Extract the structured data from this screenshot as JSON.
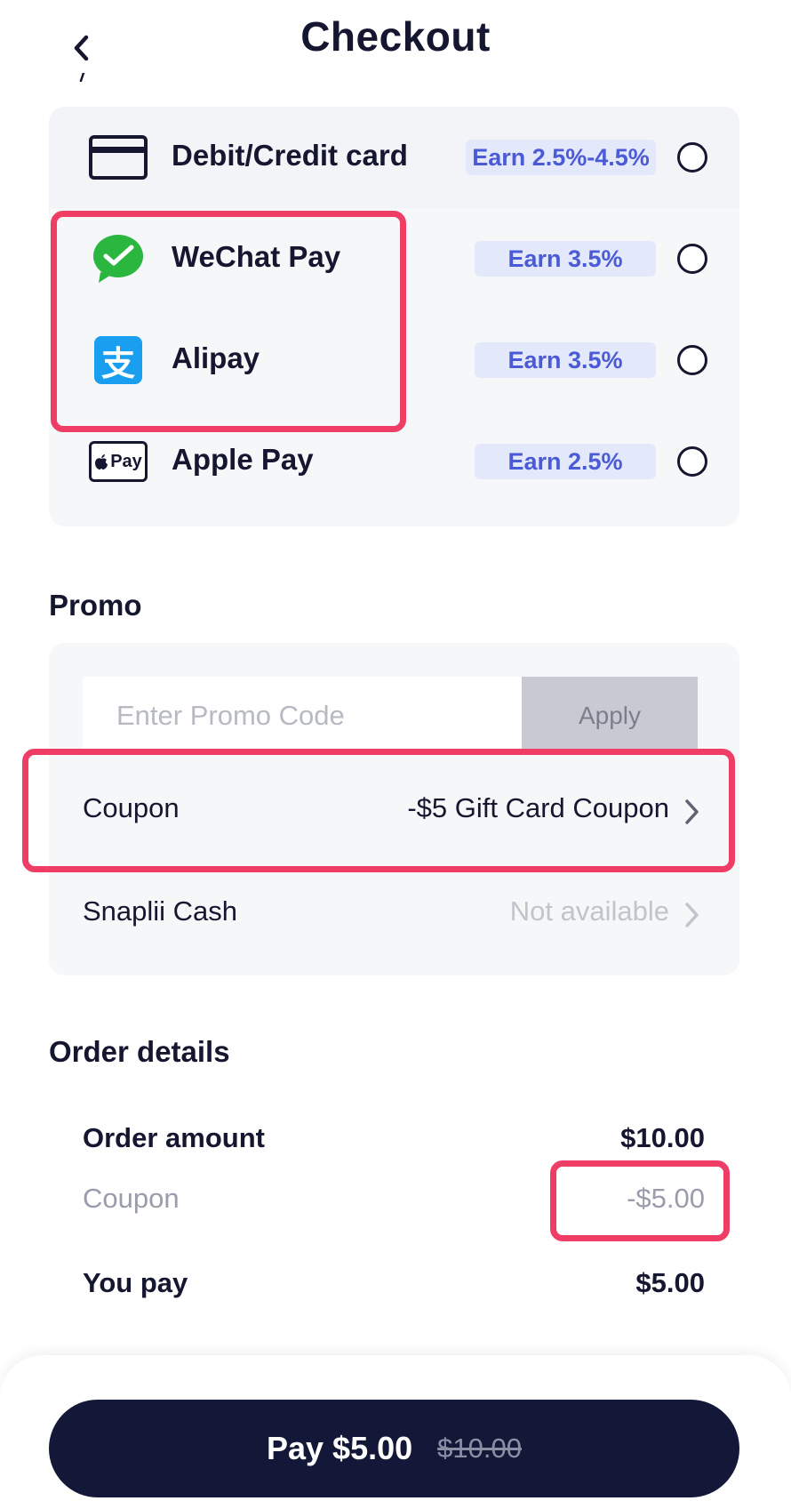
{
  "header": {
    "title": "Checkout",
    "back_icon": "chevron-left-icon"
  },
  "payment_methods": [
    {
      "name": "Debit/Credit card",
      "earn": "Earn 2.5%-4.5%",
      "icon": "credit-card-icon",
      "selected": false
    },
    {
      "name": "WeChat Pay",
      "earn": "Earn 3.5%",
      "icon": "wechat-pay-icon",
      "selected": false
    },
    {
      "name": "Alipay",
      "earn": "Earn 3.5%",
      "icon": "alipay-icon",
      "selected": false
    },
    {
      "name": "Apple Pay",
      "earn": "Earn 2.5%",
      "icon": "apple-pay-icon",
      "selected": false
    }
  ],
  "apple_pay_icon_text": "Pay",
  "alipay_icon_text": "支",
  "promo": {
    "title": "Promo",
    "input_placeholder": "Enter Promo Code",
    "input_value": "",
    "apply_label": "Apply",
    "coupon_label": "Coupon",
    "coupon_value": "-$5 Gift Card Coupon",
    "cash_label": "Snaplii Cash",
    "cash_value": "Not available"
  },
  "order": {
    "title": "Order details",
    "amount_label": "Order amount",
    "amount_value": "$10.00",
    "coupon_label": "Coupon",
    "coupon_value": "-$5.00",
    "pay_label": "You pay",
    "pay_value": "$5.00"
  },
  "pay_button": {
    "label": "Pay $5.00",
    "original_price": "$10.00"
  },
  "colors": {
    "accent": "#14172f",
    "badge_bg": "#e4e8fb",
    "badge_text": "#4b5bd6",
    "highlight": "#ef3d66",
    "wechat_green": "#2bb640",
    "alipay_blue": "#1a9ff0"
  }
}
